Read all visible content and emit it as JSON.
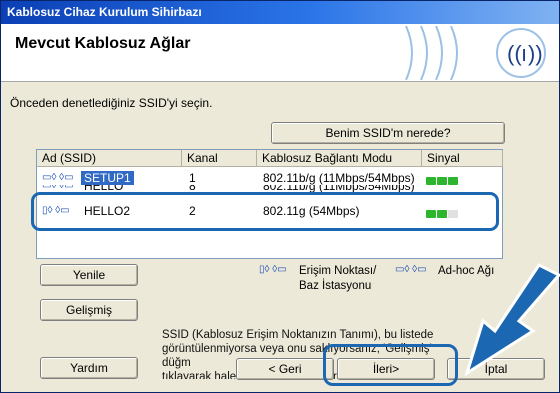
{
  "window": {
    "title": "Kablosuz Cihaz Kurulum Sihirbazı"
  },
  "header": {
    "title": "Mevcut Kablosuz Ağlar",
    "logo_icon": "wifi-signal-icon"
  },
  "prompt": "Önceden denetlediğiniz SSID'yi seçin.",
  "buttons": {
    "where_ssid": "Benim SSID'm nerede?",
    "refresh": "Yenile",
    "advanced": "Gelişmiş",
    "help": "Yardım",
    "back": "< Geri",
    "next": "İleri>",
    "cancel": "İptal"
  },
  "table": {
    "columns": [
      "Ad (SSID)",
      "Kanal",
      "Kablosuz Bağlantı Modu",
      "Sinyal"
    ],
    "rows": [
      {
        "type_icon": "adhoc-icon",
        "ssid": "SETUP1",
        "channel": "1",
        "mode": "802.11b/g (11Mbps/54Mbps)",
        "signal_bars": 3,
        "selected": true
      },
      {
        "type_icon": "adhoc-icon",
        "ssid": "HELLO",
        "channel": "8",
        "mode": "802.11b/g (11Mbps/54Mbps)",
        "signal_bars": 2,
        "selected": false
      },
      {
        "type_icon": "access-point-icon",
        "ssid": "HELLO2",
        "channel": "2",
        "mode": "802.11g (54Mbps)",
        "signal_bars": 2,
        "selected": false
      }
    ]
  },
  "legend": {
    "ap_label": "Erişim Noktası/",
    "ap_label2": "Baz İstasyonu",
    "adhoc_label": "Ad-hoc Ağı"
  },
  "info": {
    "line1": "SSID (Kablosuz Erişim Noktanızın Tanımı), bu listede",
    "line2": "görüntülenmiyorsa veya onu saklıyorsanız, 'Gelişmiş' düğm",
    "line3": "tıklayarak halen SSID'yi yapılandırabilirsiniz."
  },
  "colors": {
    "accent": "#1c67b1",
    "title_bar": "#0b3fb5",
    "selection": "#316ac5",
    "signal": "#2db52d"
  }
}
